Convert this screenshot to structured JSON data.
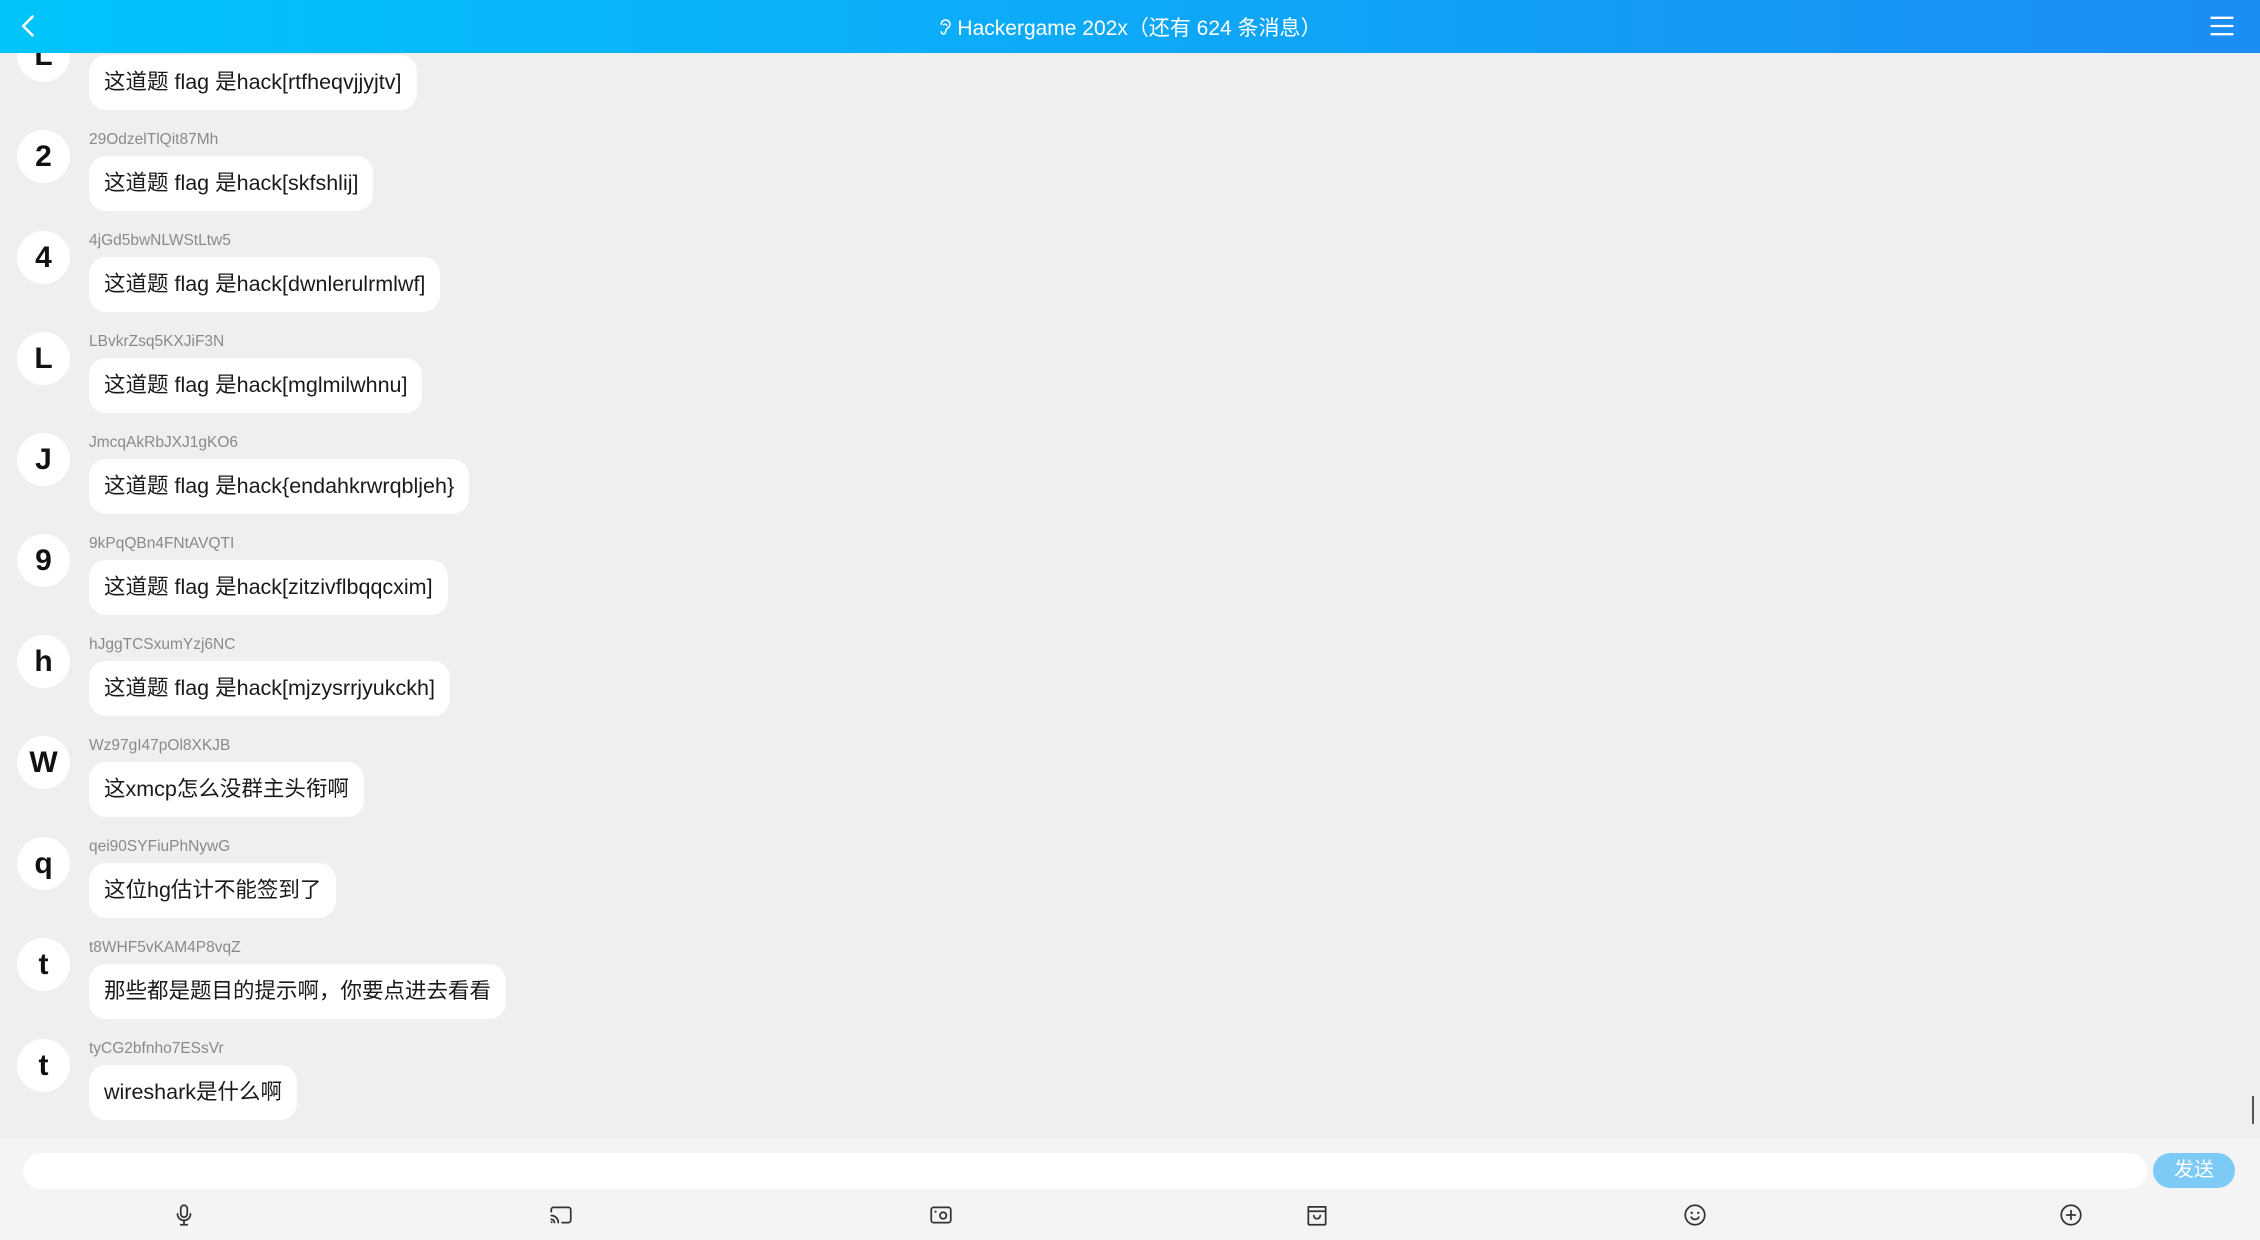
{
  "header": {
    "title": "Hackergame 202x（还有 624 条消息）",
    "back_icon": "chevron-left-icon",
    "menu_icon": "hamburger-menu-icon",
    "title_icon": "ear-icon"
  },
  "messages": [
    {
      "avatar": "L",
      "text": "这道题 flag 是hack[rtfheqvjjyjtv]"
    },
    {
      "avatar": "2",
      "user": "29OdzelTlQit87Mh",
      "text": "这道题 flag 是hack[skfshlij]"
    },
    {
      "avatar": "4",
      "user": "4jGd5bwNLWStLtw5",
      "text": "这道题 flag 是hack[dwnlerulrmlwf]"
    },
    {
      "avatar": "L",
      "user": "LBvkrZsq5KXJiF3N",
      "text": "这道题 flag 是hack[mglmilwhnu]"
    },
    {
      "avatar": "J",
      "user": "JmcqAkRbJXJ1gKO6",
      "text": "这道题 flag 是hack{endahkrwrqbljeh}"
    },
    {
      "avatar": "9",
      "user": "9kPqQBn4FNtAVQTI",
      "text": "这道题 flag 是hack[zitzivflbqqcxim]"
    },
    {
      "avatar": "h",
      "user": "hJggTCSxumYzj6NC",
      "text": "这道题 flag 是hack[mjzysrrjyukckh]"
    },
    {
      "avatar": "W",
      "user": "Wz97gI47pOl8XKJB",
      "text": "这xmcp怎么没群主头衔啊"
    },
    {
      "avatar": "q",
      "user": "qei90SYFiuPhNywG",
      "text": "这位hg估计不能签到了"
    },
    {
      "avatar": "t",
      "user": "t8WHF5vKAM4P8vqZ",
      "text": "那些都是题目的提示啊，你要点进去看看"
    },
    {
      "avatar": "t",
      "user": "tyCG2bfnho7ESsVr",
      "text": "wireshark是什么啊"
    }
  ],
  "composer": {
    "send_label": "发送"
  },
  "toolbar": {
    "icons": [
      "microphone-icon",
      "screen-cast-icon",
      "image-icon",
      "package-icon",
      "emoji-icon",
      "plus-circle-icon"
    ]
  },
  "colors": {
    "header_start": "#00c4fa",
    "header_end": "#1b8df5",
    "send_button": "#7ccaf5",
    "background": "#efefef",
    "bubble": "#ffffff"
  }
}
